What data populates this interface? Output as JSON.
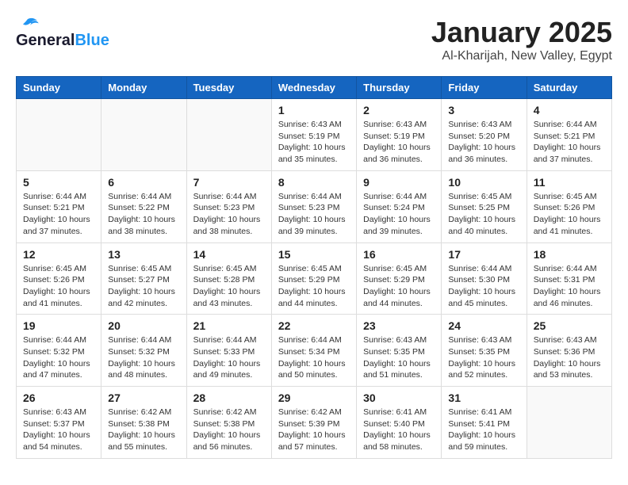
{
  "header": {
    "logo_general": "General",
    "logo_blue": "Blue",
    "title": "January 2025",
    "subtitle": "Al-Kharijah, New Valley, Egypt"
  },
  "weekdays": [
    "Sunday",
    "Monday",
    "Tuesday",
    "Wednesday",
    "Thursday",
    "Friday",
    "Saturday"
  ],
  "weeks": [
    [
      {
        "day": "",
        "info": ""
      },
      {
        "day": "",
        "info": ""
      },
      {
        "day": "",
        "info": ""
      },
      {
        "day": "1",
        "info": "Sunrise: 6:43 AM\nSunset: 5:19 PM\nDaylight: 10 hours\nand 35 minutes."
      },
      {
        "day": "2",
        "info": "Sunrise: 6:43 AM\nSunset: 5:19 PM\nDaylight: 10 hours\nand 36 minutes."
      },
      {
        "day": "3",
        "info": "Sunrise: 6:43 AM\nSunset: 5:20 PM\nDaylight: 10 hours\nand 36 minutes."
      },
      {
        "day": "4",
        "info": "Sunrise: 6:44 AM\nSunset: 5:21 PM\nDaylight: 10 hours\nand 37 minutes."
      }
    ],
    [
      {
        "day": "5",
        "info": "Sunrise: 6:44 AM\nSunset: 5:21 PM\nDaylight: 10 hours\nand 37 minutes."
      },
      {
        "day": "6",
        "info": "Sunrise: 6:44 AM\nSunset: 5:22 PM\nDaylight: 10 hours\nand 38 minutes."
      },
      {
        "day": "7",
        "info": "Sunrise: 6:44 AM\nSunset: 5:23 PM\nDaylight: 10 hours\nand 38 minutes."
      },
      {
        "day": "8",
        "info": "Sunrise: 6:44 AM\nSunset: 5:23 PM\nDaylight: 10 hours\nand 39 minutes."
      },
      {
        "day": "9",
        "info": "Sunrise: 6:44 AM\nSunset: 5:24 PM\nDaylight: 10 hours\nand 39 minutes."
      },
      {
        "day": "10",
        "info": "Sunrise: 6:45 AM\nSunset: 5:25 PM\nDaylight: 10 hours\nand 40 minutes."
      },
      {
        "day": "11",
        "info": "Sunrise: 6:45 AM\nSunset: 5:26 PM\nDaylight: 10 hours\nand 41 minutes."
      }
    ],
    [
      {
        "day": "12",
        "info": "Sunrise: 6:45 AM\nSunset: 5:26 PM\nDaylight: 10 hours\nand 41 minutes."
      },
      {
        "day": "13",
        "info": "Sunrise: 6:45 AM\nSunset: 5:27 PM\nDaylight: 10 hours\nand 42 minutes."
      },
      {
        "day": "14",
        "info": "Sunrise: 6:45 AM\nSunset: 5:28 PM\nDaylight: 10 hours\nand 43 minutes."
      },
      {
        "day": "15",
        "info": "Sunrise: 6:45 AM\nSunset: 5:29 PM\nDaylight: 10 hours\nand 44 minutes."
      },
      {
        "day": "16",
        "info": "Sunrise: 6:45 AM\nSunset: 5:29 PM\nDaylight: 10 hours\nand 44 minutes."
      },
      {
        "day": "17",
        "info": "Sunrise: 6:44 AM\nSunset: 5:30 PM\nDaylight: 10 hours\nand 45 minutes."
      },
      {
        "day": "18",
        "info": "Sunrise: 6:44 AM\nSunset: 5:31 PM\nDaylight: 10 hours\nand 46 minutes."
      }
    ],
    [
      {
        "day": "19",
        "info": "Sunrise: 6:44 AM\nSunset: 5:32 PM\nDaylight: 10 hours\nand 47 minutes."
      },
      {
        "day": "20",
        "info": "Sunrise: 6:44 AM\nSunset: 5:32 PM\nDaylight: 10 hours\nand 48 minutes."
      },
      {
        "day": "21",
        "info": "Sunrise: 6:44 AM\nSunset: 5:33 PM\nDaylight: 10 hours\nand 49 minutes."
      },
      {
        "day": "22",
        "info": "Sunrise: 6:44 AM\nSunset: 5:34 PM\nDaylight: 10 hours\nand 50 minutes."
      },
      {
        "day": "23",
        "info": "Sunrise: 6:43 AM\nSunset: 5:35 PM\nDaylight: 10 hours\nand 51 minutes."
      },
      {
        "day": "24",
        "info": "Sunrise: 6:43 AM\nSunset: 5:35 PM\nDaylight: 10 hours\nand 52 minutes."
      },
      {
        "day": "25",
        "info": "Sunrise: 6:43 AM\nSunset: 5:36 PM\nDaylight: 10 hours\nand 53 minutes."
      }
    ],
    [
      {
        "day": "26",
        "info": "Sunrise: 6:43 AM\nSunset: 5:37 PM\nDaylight: 10 hours\nand 54 minutes."
      },
      {
        "day": "27",
        "info": "Sunrise: 6:42 AM\nSunset: 5:38 PM\nDaylight: 10 hours\nand 55 minutes."
      },
      {
        "day": "28",
        "info": "Sunrise: 6:42 AM\nSunset: 5:38 PM\nDaylight: 10 hours\nand 56 minutes."
      },
      {
        "day": "29",
        "info": "Sunrise: 6:42 AM\nSunset: 5:39 PM\nDaylight: 10 hours\nand 57 minutes."
      },
      {
        "day": "30",
        "info": "Sunrise: 6:41 AM\nSunset: 5:40 PM\nDaylight: 10 hours\nand 58 minutes."
      },
      {
        "day": "31",
        "info": "Sunrise: 6:41 AM\nSunset: 5:41 PM\nDaylight: 10 hours\nand 59 minutes."
      },
      {
        "day": "",
        "info": ""
      }
    ]
  ]
}
